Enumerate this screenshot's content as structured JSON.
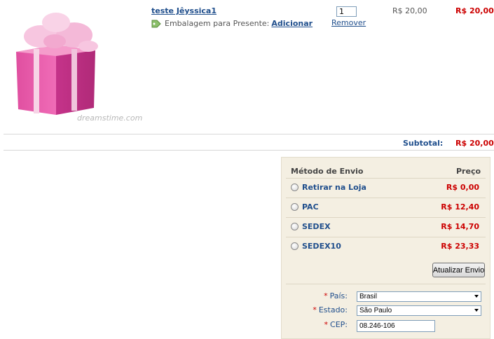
{
  "cart": {
    "item": {
      "name": "teste Jêyssica1",
      "gift_wrap_text": "Embalagem para Presente:",
      "gift_wrap_action": "Adicionar",
      "quantity": "1",
      "remove_label": "Remover",
      "unit_price": "R$ 20,00",
      "total_price": "R$ 20,00",
      "image_watermark": "dreamstime.com"
    },
    "subtotal_label": "Subtotal:",
    "subtotal_value": "R$ 20,00"
  },
  "shipping": {
    "header_method": "Método de Envio",
    "header_price": "Preço",
    "options": [
      {
        "label": "Retirar na Loja",
        "price": "R$ 0,00"
      },
      {
        "label": "PAC",
        "price": "R$ 12,40"
      },
      {
        "label": "SEDEX",
        "price": "R$ 14,70"
      },
      {
        "label": "SEDEX10",
        "price": "R$ 23,33"
      }
    ],
    "update_button": "Atualizar Envio",
    "form": {
      "required_mark": "*",
      "country_label": "País:",
      "country_value": "Brasil",
      "state_label": "Estado:",
      "state_value": "São Paulo",
      "cep_label": "CEP:",
      "cep_value": "08.246-106"
    }
  },
  "colors": {
    "link": "#1f4e8c",
    "price": "#cc0000",
    "panel": "#f4efe2"
  }
}
